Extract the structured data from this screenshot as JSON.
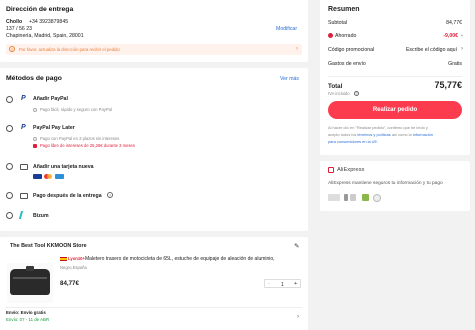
{
  "address": {
    "title": "Dirección de entrega",
    "name": "Chollo",
    "phone": "+34 3923879845",
    "line1": "137 / 56 23",
    "line2": "Chapinería, Madrid, Spain, 28001",
    "modify_label": "Modificar",
    "warning": "Por favor, actualiza la dirección para recibir el pedido"
  },
  "payment": {
    "title": "Métodos de pago",
    "see_more": "Ver más",
    "methods": [
      {
        "label": "Añadir PayPal",
        "note": "Pago fácil, rápido y seguro con PayPal",
        "note2": ""
      },
      {
        "label": "PayPal Pay Later",
        "note": "Pago con PayPal en 3 plazos sin intereses",
        "note2": "Pago libre de intereses de 25,26€ durante 3 meses"
      },
      {
        "label": "Añadir una tarjeta nueva",
        "note": "",
        "note2": ""
      },
      {
        "label": "Pago después de la entrega",
        "note": "",
        "note2": ""
      },
      {
        "label": "Bizum",
        "note": "",
        "note2": ""
      }
    ]
  },
  "store": {
    "name": "The Best Tool KKMOON Store",
    "badge": "Lyon10+",
    "product_title": "Maletero trasero de motocicleta de 65L, estuche de equipaje de aleación de aluminio,",
    "variant": "Negro,España",
    "price": "84,77€",
    "quantity": "1",
    "minus": "-",
    "plus": "+",
    "shipping_label": "Envío: Envío gratis",
    "delivery": "Envío: 07 - 11 de ABR"
  },
  "summary": {
    "title": "Resumen",
    "subtotal_label": "Subtotal",
    "subtotal_value": "84,77€",
    "saved_label": "Ahorrado",
    "saved_value": "-9,00€",
    "promo_label": "Código promocional",
    "promo_value": "Escribe el código aquí",
    "shipping_label": "Gastos de envío",
    "shipping_value": "Gratis",
    "total_label": "Total",
    "total_value": "75,77€",
    "vat_label": "IVA incluido",
    "order_button": "Realizar pedido",
    "legal_1": "Al hacer clic en \"Realizar pedido\", confirmo que he leído y",
    "legal_2a": "acepto todos los ",
    "legal_link1": "términos y políticas",
    "legal_2b": " así como la ",
    "legal_link2": "información",
    "legal_3": "para consumidores en la UE."
  },
  "trust": {
    "brand": "AliExpress",
    "text": "AliExpress mantiene seguros tu información y tu pago"
  },
  "colors": {
    "accent": "#fd3b4e",
    "link": "#2a6fd6",
    "warning_bg": "#fff1ec"
  }
}
